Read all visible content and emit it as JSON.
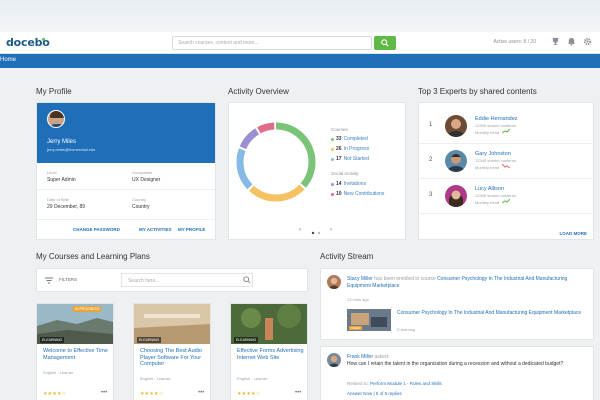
{
  "colors": {
    "primary": "#1e6fb8",
    "accent": "#5fb946",
    "completed": "#7cc37a",
    "in_progress": "#f4c262",
    "not_started": "#85b9e6",
    "invitations": "#9b8fd1",
    "new_contributions": "#e06b8b"
  },
  "header": {
    "logo": "docebo",
    "search_placeholder": "Search courses, content and more...",
    "active_users": "Active users: 8 / 20",
    "icons": [
      "search-icon",
      "trophy-icon",
      "bell-icon",
      "gear-icon"
    ]
  },
  "nav": {
    "label": "Home"
  },
  "profile": {
    "section_title": "My Profile",
    "name": "Jerry Miles",
    "email": "jerry.miles@homeretail.info",
    "fields": [
      {
        "label": "Level",
        "value": "Super Admin"
      },
      {
        "label": "Occupation",
        "value": "UX Designer"
      },
      {
        "label": "Date of Birth",
        "value": "29 December, 89"
      },
      {
        "label": "Country",
        "value": "Country"
      }
    ],
    "links": [
      "CHANGE PASSWORD",
      "MY ACTIVITIES",
      "MY PROFILE"
    ]
  },
  "activity": {
    "section_title": "Activity Overview",
    "courses_label": "Courses",
    "social_label": "Social Activity",
    "completed": {
      "count": "33",
      "label": "Completed"
    },
    "in_progress": {
      "count": "26",
      "label": "In Progress"
    },
    "not_started": {
      "count": "17",
      "label": "Not Started"
    },
    "invitations": {
      "count": "14",
      "label": "Invitations"
    },
    "new_contributions": {
      "count": "10",
      "label": "New Contributions"
    },
    "pager": {
      "prev": "‹",
      "next": "›"
    }
  },
  "experts": {
    "section_title": "Top 3 Experts by shared contents",
    "items": [
      {
        "rank": "1",
        "name": "Eddie Hernandez",
        "sub": "12345 shared contents",
        "trend": "Monthly trend"
      },
      {
        "rank": "2",
        "name": "Gary Johnston",
        "sub": "12345 shared contents",
        "trend": "Monthly trend"
      },
      {
        "rank": "3",
        "name": "Lucy Allison",
        "sub": "12345 shared contents",
        "trend": "Monthly trend"
      }
    ],
    "load_more": "LOAD MORE"
  },
  "courses": {
    "section_title": "My Courses and Learning Plans",
    "filters_label": "FILTERS",
    "search_placeholder": "Search here...",
    "items": [
      {
        "badge": "IN PROGRESS",
        "tag": "ELEARNING",
        "title": "Welcome to Effective Time Management",
        "meta": "English - Learner",
        "stars": "★★★★☆",
        "more": "•••"
      },
      {
        "badge": "",
        "tag": "ELEARNING",
        "title": "Choosing The Best Audio Player Software For Your Computer",
        "meta": "English - Learner",
        "stars": "★★★★☆",
        "more": "•••"
      },
      {
        "badge": "",
        "tag": "ELEARNING",
        "title": "Effective Forms Advertising Internet Web Site",
        "meta": "English - Learner",
        "stars": "★★★★☆",
        "more": "•••"
      }
    ]
  },
  "stream": {
    "section_title": "Activity Stream",
    "item1": {
      "user": "Stacy Miller",
      "action": "has been enrolled in course",
      "course": "Consumer Psychology In The Industrial And Manufacturing Equipment Marketplace",
      "time": "23 mins ago",
      "thumb_tag": "VIDEO",
      "course_line": "Consumer Psychology In The Industrial And Manufacturing Equipment Marketplace",
      "course_sub": "E-learning"
    },
    "item2": {
      "user": "Frank Miller",
      "action": "asked:",
      "question": "How can I retain the talent in the organization during a recession and without a dedicated budget?",
      "related_label": "Related to:",
      "related": "Perform Module 1 - Roles and Skills",
      "actions": "Answer Now  |  5 of 5 replies"
    }
  }
}
